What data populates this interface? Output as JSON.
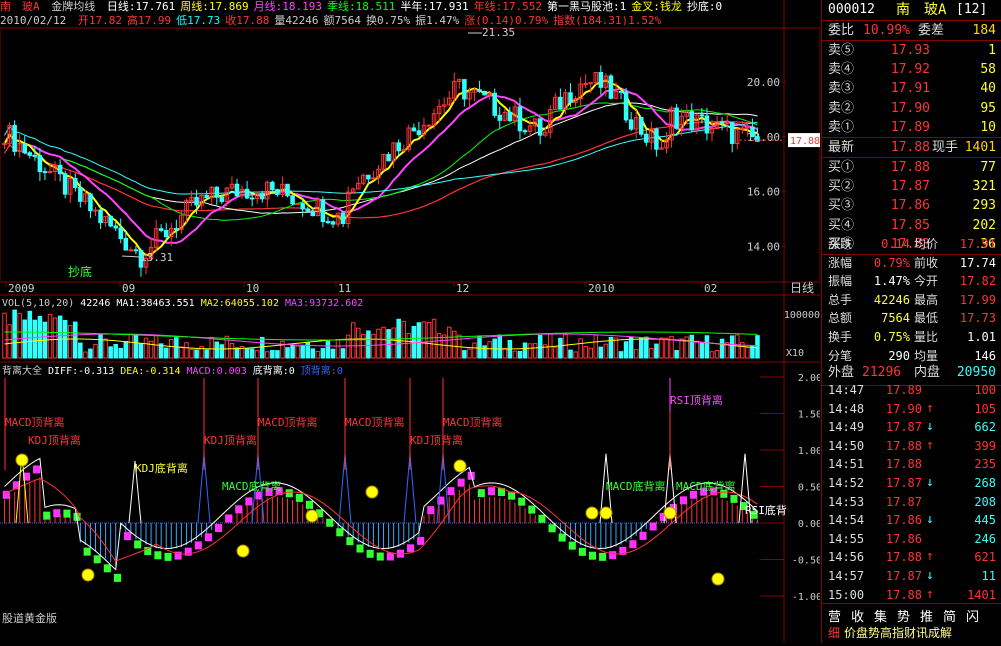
{
  "header": {
    "stock_name": "南　玻A",
    "indicator_name": "金牌均线",
    "ma_items": [
      {
        "label": "日线:17.761",
        "color": "#ffffff"
      },
      {
        "label": "周线:17.869",
        "color": "#ffff00"
      },
      {
        "label": "月线:18.193",
        "color": "#ff44ff"
      },
      {
        "label": "季线:18.511",
        "color": "#00ff00"
      },
      {
        "label": "半年:17.931",
        "color": "#ffffff"
      },
      {
        "label": "年线:17.552",
        "color": "#ff3333"
      },
      {
        "label": "第一黑马股池:1",
        "color": "#ffffff"
      },
      {
        "label": "金叉:钱龙",
        "color": "#ffff00"
      },
      {
        "label": "抄底:0",
        "color": "#ffffff"
      }
    ],
    "date": "2010/02/12",
    "ohlc": [
      {
        "label": "开17.82",
        "color": "#ff3333"
      },
      {
        "label": "高17.99",
        "color": "#ff3333"
      },
      {
        "label": "低17.73",
        "color": "#00ffff"
      },
      {
        "label": "收17.88",
        "color": "#ff3333"
      },
      {
        "label": "量42246",
        "color": "#cccccc"
      },
      {
        "label": "额7564",
        "color": "#cccccc"
      },
      {
        "label": "换0.75%",
        "color": "#cccccc"
      },
      {
        "label": "振1.47%",
        "color": "#cccccc"
      },
      {
        "label": "涨(0.14)0.79%",
        "color": "#ff3333"
      },
      {
        "label": "指数(184.31)1.52%",
        "color": "#ff3333"
      }
    ]
  },
  "main_chart": {
    "y_ticks": [
      "20.00",
      "18.00",
      "16.00",
      "14.00"
    ],
    "current_price_tag": "17.88",
    "high_annotation": "21.35",
    "low_annotation": "13.31",
    "bottom_signal": "抄底",
    "x_ticks": [
      "2009",
      "09",
      "10",
      "11",
      "12",
      "2010",
      "02"
    ],
    "period": "日线"
  },
  "volume": {
    "title": "VOL(5,10,20)",
    "value": "42246",
    "ma1": "MA1:38463.551",
    "ma2": "MA2:64055.102",
    "ma3": "MA3:93732.602",
    "y_tick": "100000",
    "unit": "X10"
  },
  "macd": {
    "title": "背离大全",
    "diff": "DIFF:-0.313",
    "dea": "DEA:-0.314",
    "macd": "MACD:0.003",
    "bottom_div": "底背离:0",
    "top_div": "顶背离:0",
    "y_ticks": [
      "2.00",
      "1.50",
      "1.00",
      "0.50",
      "0.00",
      "-0.50",
      "-1.00"
    ],
    "labels": [
      {
        "text": "MACD顶背离",
        "color": "#ff3333"
      },
      {
        "text": "KDJ顶背离",
        "color": "#ff3333"
      },
      {
        "text": "KDJ顶背离",
        "color": "#ff3333"
      },
      {
        "text": "MACD顶背离",
        "color": "#ff3333"
      },
      {
        "text": "MACD顶背离",
        "color": "#ff3333"
      },
      {
        "text": "KDJ顶背离",
        "color": "#ff3333"
      },
      {
        "text": "MACD顶背离",
        "color": "#ff3333"
      },
      {
        "text": "RSI顶背离",
        "color": "#ff44ff"
      },
      {
        "text": "KDJ底背离",
        "color": "#ffff33"
      },
      {
        "text": "MACD底背离",
        "color": "#33ff33"
      },
      {
        "text": "MACD底背离",
        "color": "#33ff33"
      },
      {
        "text": "MACD底背离",
        "color": "#33ff33"
      },
      {
        "text": "RSI底背",
        "color": "#ffffff"
      }
    ],
    "footer": "股道黄金版"
  },
  "panel": {
    "code": "000012",
    "name": "南　玻A",
    "tag": "[12]",
    "weibi_label": "委比",
    "weibi_value": "10.99%",
    "weicha_label": "委差",
    "weicha_value": "184",
    "sell": [
      {
        "label": "卖⑤",
        "price": "17.93",
        "vol": "1"
      },
      {
        "label": "卖④",
        "price": "17.92",
        "vol": "58"
      },
      {
        "label": "卖③",
        "price": "17.91",
        "vol": "40"
      },
      {
        "label": "卖②",
        "price": "17.90",
        "vol": "95"
      },
      {
        "label": "卖①",
        "price": "17.89",
        "vol": "10"
      }
    ],
    "latest_label": "最新",
    "latest_value": "17.88",
    "now_label": "现手",
    "now_value": "1401",
    "buy": [
      {
        "label": "买①",
        "price": "17.88",
        "vol": "77"
      },
      {
        "label": "买②",
        "price": "17.87",
        "vol": "321"
      },
      {
        "label": "买③",
        "price": "17.86",
        "vol": "293"
      },
      {
        "label": "买④",
        "price": "17.85",
        "vol": "202"
      },
      {
        "label": "买⑤",
        "price": "17.83",
        "vol": "36"
      }
    ],
    "stats": [
      {
        "l1": "涨跌",
        "v1": "0.14",
        "c1": "#ff3333",
        "l2": "均价",
        "v2": "17.91",
        "c2": "#ff3333"
      },
      {
        "l1": "涨幅",
        "v1": "0.79%",
        "c1": "#ff3333",
        "l2": "前收",
        "v2": "17.74",
        "c2": "#ffffff"
      },
      {
        "l1": "振幅",
        "v1": "1.47%",
        "c1": "#ffffff",
        "l2": "今开",
        "v2": "17.82",
        "c2": "#ff3333"
      },
      {
        "l1": "总手",
        "v1": "42246",
        "c1": "#ffff33",
        "l2": "最高",
        "v2": "17.99",
        "c2": "#ff3333"
      },
      {
        "l1": "总额",
        "v1": "7564",
        "c1": "#ffff33",
        "l2": "最低",
        "v2": "17.73",
        "c2": "#ff3333"
      },
      {
        "l1": "换手",
        "v1": "0.75%",
        "c1": "#ffff33",
        "l2": "量比",
        "v2": "1.01",
        "c2": "#ffffff"
      },
      {
        "l1": "分笔",
        "v1": "290",
        "c1": "#ffffff",
        "l2": "均量",
        "v2": "146",
        "c2": "#ffffff"
      }
    ],
    "outer_label": "外盘",
    "outer_value": "21296",
    "inner_label": "内盘",
    "inner_value": "20950",
    "ticks": [
      {
        "time": "14:47",
        "price": "17.89",
        "arrow": "",
        "vol": "100",
        "dir": "up"
      },
      {
        "time": "14:48",
        "price": "17.90",
        "arrow": "↑",
        "vol": "105",
        "dir": "up"
      },
      {
        "time": "14:49",
        "price": "17.87",
        "arrow": "↓",
        "vol": "662",
        "dir": "down"
      },
      {
        "time": "14:50",
        "price": "17.88",
        "arrow": "↑",
        "vol": "399",
        "dir": "up"
      },
      {
        "time": "14:51",
        "price": "17.88",
        "arrow": "",
        "vol": "235",
        "dir": "up"
      },
      {
        "time": "14:52",
        "price": "17.87",
        "arrow": "↓",
        "vol": "268",
        "dir": "down"
      },
      {
        "time": "14:53",
        "price": "17.87",
        "arrow": "",
        "vol": "208",
        "dir": "down"
      },
      {
        "time": "14:54",
        "price": "17.86",
        "arrow": "↓",
        "vol": "445",
        "dir": "down"
      },
      {
        "time": "14:55",
        "price": "17.86",
        "arrow": "",
        "vol": "246",
        "dir": "down"
      },
      {
        "time": "14:56",
        "price": "17.88",
        "arrow": "↑",
        "vol": "621",
        "dir": "up"
      },
      {
        "time": "14:57",
        "price": "17.87",
        "arrow": "↓",
        "vol": "11",
        "dir": "down"
      },
      {
        "time": "15:00",
        "price": "17.88",
        "arrow": "↑",
        "vol": "1401",
        "dir": "up"
      }
    ],
    "bottom_tabs": [
      "营",
      "收",
      "集",
      "势",
      "推",
      "简",
      "闪"
    ],
    "bottom_mark": "细",
    "watermark": "价盘势高指财讯成解",
    "colors": {
      "up": "#ff3333",
      "down": "#33ffff",
      "accent": "#ffff33"
    }
  }
}
